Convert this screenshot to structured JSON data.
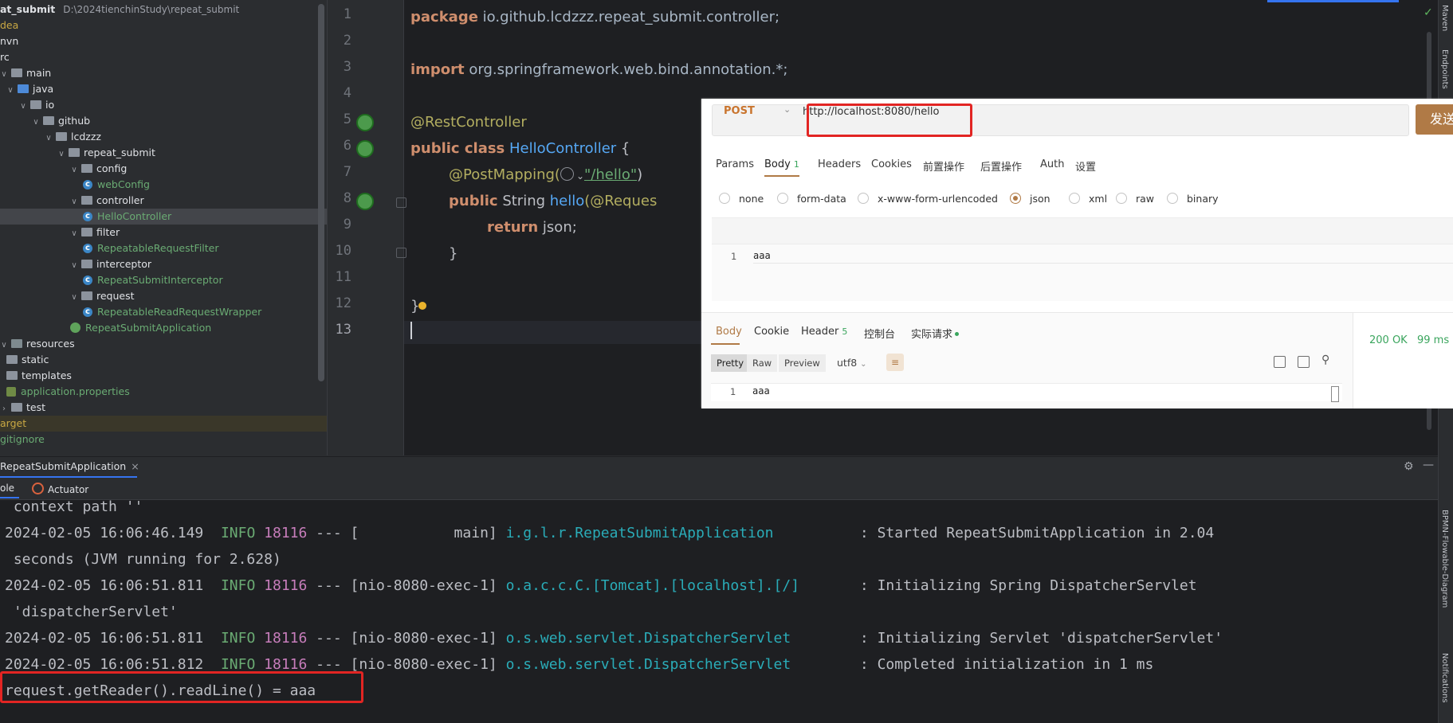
{
  "project": {
    "root_name": "at_submit",
    "root_path": "D:\\2024tienchinStudy\\repeat_submit",
    "items": [
      {
        "label": "dea",
        "kind": "folder-yellow",
        "indent": 0,
        "chev": ""
      },
      {
        "label": "nvn",
        "kind": "plain",
        "indent": 0,
        "chev": ""
      },
      {
        "label": "rc",
        "kind": "plain",
        "indent": 0,
        "chev": ""
      },
      {
        "label": "main",
        "kind": "folder",
        "indent": 0,
        "chev": "v"
      },
      {
        "label": "java",
        "kind": "folder-blue",
        "indent": 1,
        "chev": "v"
      },
      {
        "label": "io",
        "kind": "folder",
        "indent": 2,
        "chev": "v"
      },
      {
        "label": "github",
        "kind": "folder",
        "indent": 3,
        "chev": "v"
      },
      {
        "label": "lcdzzz",
        "kind": "folder",
        "indent": 4,
        "chev": "v"
      },
      {
        "label": "repeat_submit",
        "kind": "folder",
        "indent": 5,
        "chev": "v"
      },
      {
        "label": "config",
        "kind": "folder",
        "indent": 6,
        "chev": "v"
      },
      {
        "label": "webConfig",
        "kind": "class",
        "indent": 7,
        "chev": ""
      },
      {
        "label": "controller",
        "kind": "folder",
        "indent": 6,
        "chev": "v"
      },
      {
        "label": "HelloController",
        "kind": "class-selected",
        "indent": 7,
        "chev": ""
      },
      {
        "label": "filter",
        "kind": "folder",
        "indent": 6,
        "chev": "v"
      },
      {
        "label": "RepeatableRequestFilter",
        "kind": "class",
        "indent": 7,
        "chev": ""
      },
      {
        "label": "interceptor",
        "kind": "folder",
        "indent": 6,
        "chev": "v"
      },
      {
        "label": "RepeatSubmitInterceptor",
        "kind": "class",
        "indent": 7,
        "chev": ""
      },
      {
        "label": "request",
        "kind": "folder",
        "indent": 6,
        "chev": "v"
      },
      {
        "label": "RepeatableReadRequestWrapper",
        "kind": "class",
        "indent": 7,
        "chev": ""
      },
      {
        "label": "RepeatSubmitApplication",
        "kind": "app",
        "indent": 6,
        "chev": ""
      },
      {
        "label": "resources",
        "kind": "folder-res",
        "indent": 0,
        "chev": "v"
      },
      {
        "label": "static",
        "kind": "folder",
        "indent": 1,
        "chev": ""
      },
      {
        "label": "templates",
        "kind": "folder",
        "indent": 1,
        "chev": ""
      },
      {
        "label": "application.properties",
        "kind": "leaf",
        "indent": 1,
        "chev": ""
      },
      {
        "label": "test",
        "kind": "folder",
        "indent": 0,
        "chev": ">"
      },
      {
        "label": "arget",
        "kind": "target",
        "indent": 0,
        "chev": ""
      },
      {
        "label": "gitignore",
        "kind": "green-text",
        "indent": 0,
        "chev": ""
      }
    ]
  },
  "editor": {
    "line_numbers": [
      "1",
      "2",
      "3",
      "4",
      "5",
      "6",
      "7",
      "8",
      "9",
      "10",
      "11",
      "12",
      "13"
    ],
    "l1": {
      "kw": "package",
      "rest": " io.github.lcdzzz.repeat_submit.controller;"
    },
    "l3": {
      "kw": "import",
      "rest": " org.springframework.web.bind.annotation.*;"
    },
    "l5": {
      "ann": "@RestController"
    },
    "l6": {
      "kw": "public class",
      "name": " HelloController",
      "rest": " {"
    },
    "l7": {
      "ann": "@PostMapping(",
      "str": "\"/hello\"",
      "rest": ")"
    },
    "l8": {
      "kw": "public",
      "type": " String",
      "fn": " hello",
      "rest": "(@Reques"
    },
    "l9": {
      "kw": "return",
      "rest": " json;"
    },
    "l10": {
      "rest": "}"
    },
    "l12": {
      "rest": "}"
    }
  },
  "right_strip": {
    "maven": "Maven",
    "endpoints": "Endpoints",
    "bpmn": "BPMN-Flowable-Diagram",
    "notifications": "Notifications"
  },
  "postman": {
    "method": "POST",
    "url": "http://localhost:8080/hello",
    "send": "发送",
    "tabs": [
      {
        "label": "Params"
      },
      {
        "label": "Body",
        "badge": "1"
      },
      {
        "label": "Headers"
      },
      {
        "label": "Cookies"
      },
      {
        "label": "前置操作"
      },
      {
        "label": "后置操作"
      },
      {
        "label": "Auth"
      },
      {
        "label": "设置"
      }
    ],
    "body_types": [
      "none",
      "form-data",
      "x-www-form-urlencoded",
      "json",
      "xml",
      "raw",
      "binary"
    ],
    "selected_body_type": "json",
    "request_body_line_num": "1",
    "request_body_text": "aaa",
    "response_tabs": [
      {
        "label": "Body"
      },
      {
        "label": "Cookie"
      },
      {
        "label": "Header",
        "badge": "5"
      },
      {
        "label": "控制台"
      },
      {
        "label": "实际请求"
      }
    ],
    "view_modes": [
      "Pretty",
      "Raw",
      "Preview"
    ],
    "encoding": "utf8",
    "status": "200 OK",
    "time": "99 ms",
    "response_line_num": "1",
    "response_text": "aaa"
  },
  "run": {
    "tab": "RepeatSubmitApplication",
    "subtabs": [
      "ole",
      "Actuator"
    ],
    "lines": [
      {
        "plain": " context path ''"
      },
      {
        "ts": "2024-02-05 16:06:46.149",
        "level": "INFO",
        "pid": "18116",
        "thread": " --- [           main] ",
        "logger": "i.g.l.r.RepeatSubmitApplication         ",
        "msg": " : Started RepeatSubmitApplication in 2.04"
      },
      {
        "plain": " seconds (JVM running for 2.628)"
      },
      {
        "ts": "2024-02-05 16:06:51.811",
        "level": "INFO",
        "pid": "18116",
        "thread": " --- [nio-8080-exec-1] ",
        "logger": "o.a.c.c.C.[Tomcat].[localhost].[/]      ",
        "msg": " : Initializing Spring DispatcherServlet"
      },
      {
        "plain": " 'dispatcherServlet'"
      },
      {
        "ts": "2024-02-05 16:06:51.811",
        "level": "INFO",
        "pid": "18116",
        "thread": " --- [nio-8080-exec-1] ",
        "logger": "o.s.web.servlet.DispatcherServlet       ",
        "msg": " : Initializing Servlet 'dispatcherServlet'"
      },
      {
        "ts": "2024-02-05 16:06:51.812",
        "level": "INFO",
        "pid": "18116",
        "thread": " --- [nio-8080-exec-1] ",
        "logger": "o.s.web.servlet.DispatcherServlet       ",
        "msg": " : Completed initialization in 1 ms"
      },
      {
        "plain": "request.getReader().readLine() = aaa"
      }
    ]
  },
  "colors": {
    "accent": "#3574f0",
    "postman_orange": "#b07a46",
    "highlight_red": "#e22523",
    "ok_green": "#3aa55d"
  }
}
